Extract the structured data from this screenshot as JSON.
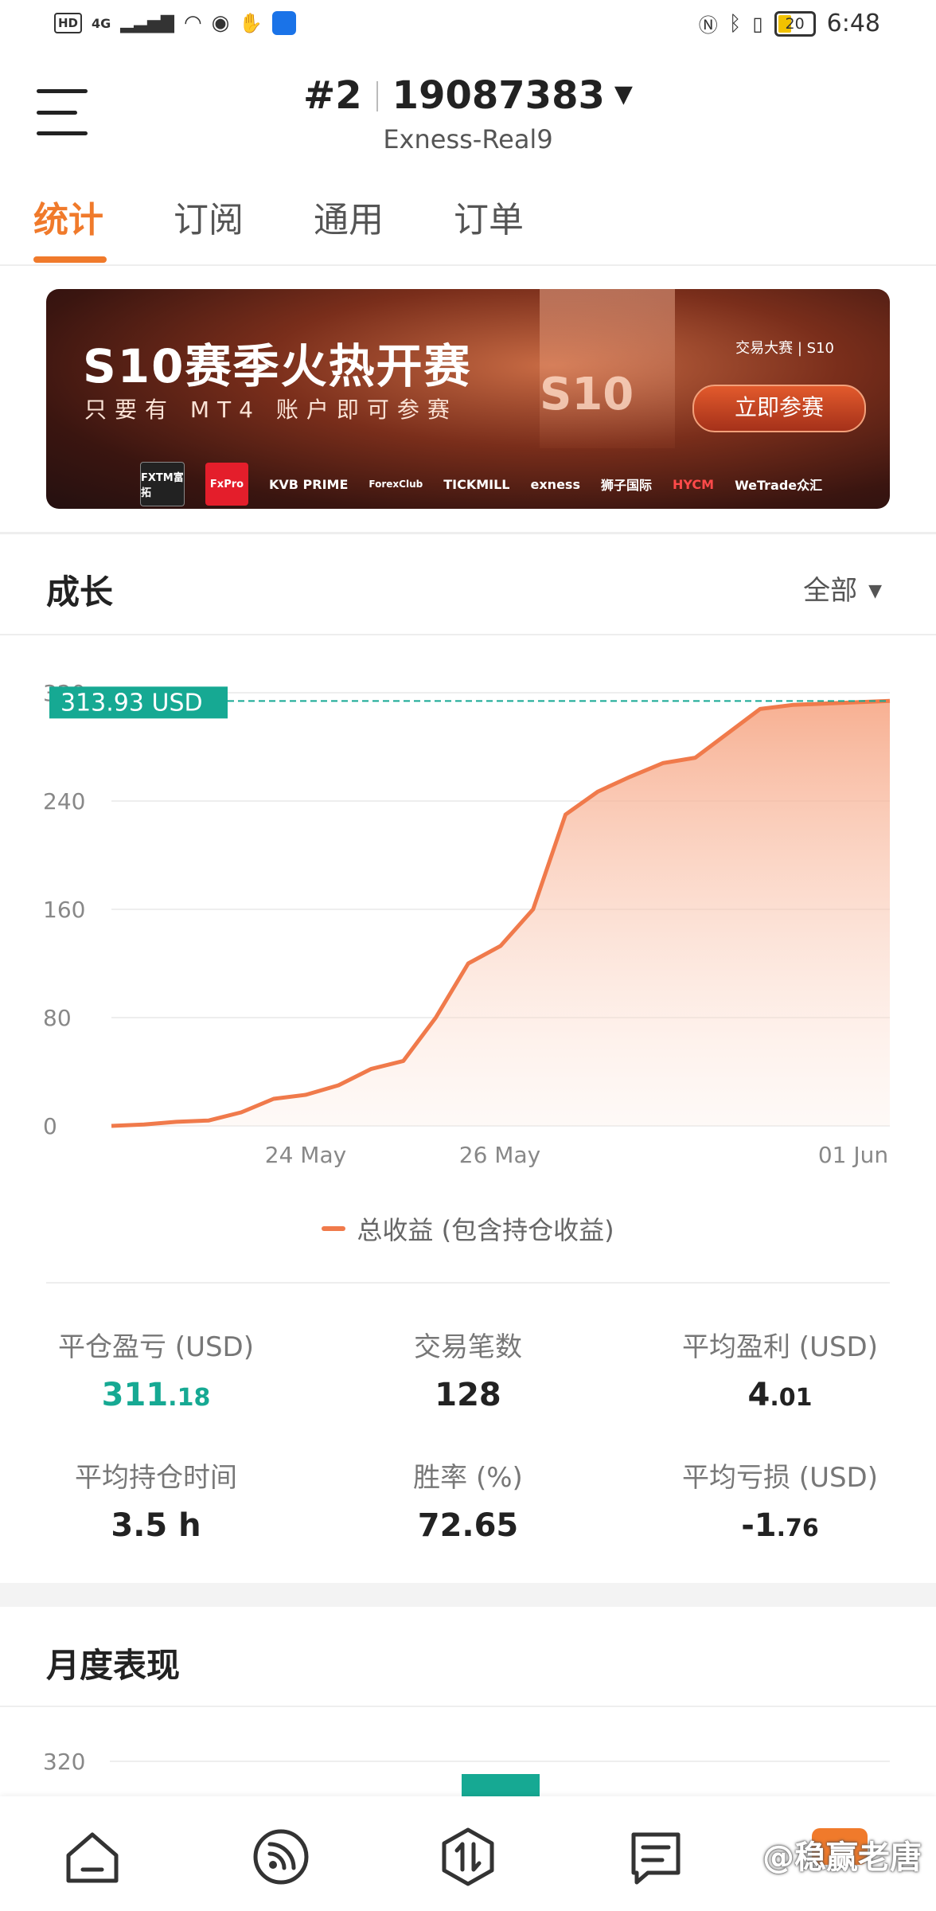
{
  "status_bar": {
    "hd": "HD",
    "network": "4G",
    "battery": "20",
    "time": "6:48"
  },
  "header": {
    "account_index": "#2",
    "account_number": "19087383",
    "server": "Exness-Real9"
  },
  "tabs": [
    {
      "label": "统计",
      "active": true
    },
    {
      "label": "订阅",
      "active": false
    },
    {
      "label": "通用",
      "active": false
    },
    {
      "label": "订单",
      "active": false
    }
  ],
  "banner": {
    "title": "S10赛季火热开赛",
    "subtitle": "只要有 MT4 账户即可参赛",
    "center_text": "S10",
    "brand": "交易大赛 | S10",
    "cta": "立即参赛",
    "sponsors": [
      "FXTM富拓",
      "FxPro",
      "KVB PRIME",
      "ForexClub",
      "TICKMILL",
      "exness",
      "狮子国际",
      "HYCM",
      "WeTrade众汇"
    ]
  },
  "growth": {
    "title": "成长",
    "filter": "全部"
  },
  "chart_data": {
    "type": "area",
    "title": "",
    "current_value_label": "313.93 USD",
    "current_value": 313.93,
    "y_ticks": [
      "0",
      "80",
      "160",
      "240",
      "320"
    ],
    "ylim": [
      0,
      320
    ],
    "x_ticks": [
      "24 May",
      "26 May",
      "01 Jun"
    ],
    "series": [
      {
        "name": "总收益 (包含持仓收益)",
        "color": "#f07a4b",
        "values": [
          0,
          1,
          3,
          4,
          10,
          20,
          23,
          30,
          42,
          48,
          80,
          120,
          133,
          160,
          230,
          247,
          258,
          268,
          272,
          290,
          308,
          311,
          312,
          313,
          313.93
        ]
      }
    ],
    "legend": "总收益 (包含持仓收益)"
  },
  "stats": [
    {
      "label": "平仓盈亏 (USD)",
      "int": "311",
      "dec": ".18",
      "green": true
    },
    {
      "label": "交易笔数",
      "int": "128",
      "dec": "",
      "green": false
    },
    {
      "label": "平均盈利 (USD)",
      "int": "4",
      "dec": ".01",
      "green": false
    },
    {
      "label": "平均持仓时间",
      "int": "3.5 h",
      "dec": "",
      "green": false
    },
    {
      "label": "胜率 (%)",
      "int": "72.65",
      "dec": "",
      "green": false
    },
    {
      "label": "平均亏损 (USD)",
      "int": "-1",
      "dec": ".76",
      "green": false
    }
  ],
  "monthly": {
    "title": "月度表现",
    "y_tick": "320"
  },
  "bottom_nav": [
    {
      "icon": "home-icon"
    },
    {
      "icon": "signal-icon"
    },
    {
      "icon": "trade-icon"
    },
    {
      "icon": "notes-icon"
    }
  ],
  "watermark": "@稳赢老唐",
  "colors": {
    "accent": "#f07a2b",
    "positive": "#16a993",
    "line": "#f07a4b"
  }
}
